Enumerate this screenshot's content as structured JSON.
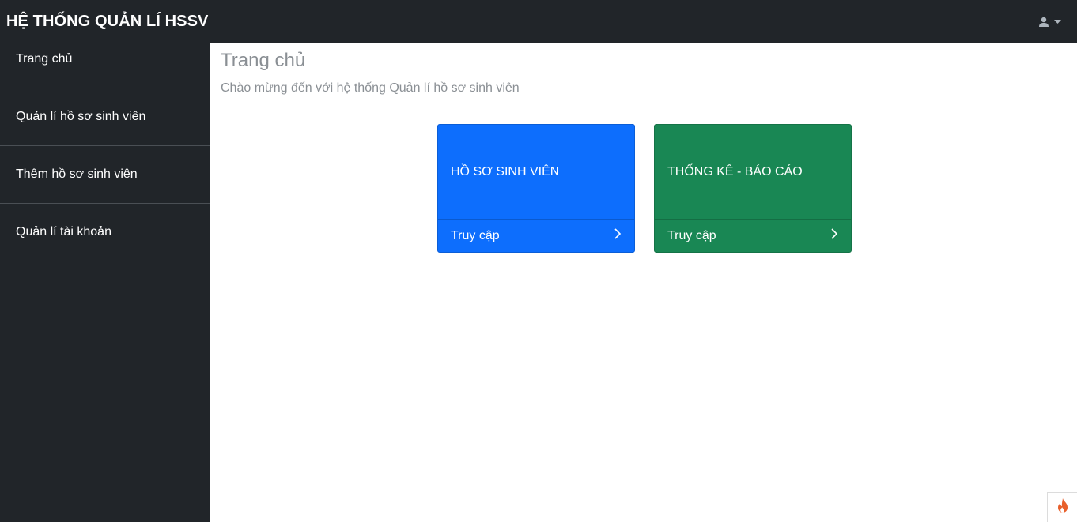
{
  "header": {
    "brand": "HỆ THỐNG QUẢN LÍ HSSV",
    "user_icon": "user-icon",
    "dropdown_icon": "caret-down-icon"
  },
  "sidebar": {
    "items": [
      {
        "label": "Trang chủ"
      },
      {
        "label": "Quản lí hồ sơ sinh viên"
      },
      {
        "label": "Thêm hồ sơ sinh viên"
      },
      {
        "label": "Quản lí tài khoản"
      }
    ]
  },
  "main": {
    "title": "Trang chủ",
    "subtitle": "Chào mừng đến với hệ thống Quản lí hồ sơ sinh viên",
    "cards": [
      {
        "title": "HỒ SƠ SINH VIÊN",
        "action": "Truy cập",
        "color": "#0d6efd",
        "icon": "chevron-right-icon"
      },
      {
        "title": "THỐNG KÊ - BÁO CÁO",
        "action": "Truy cập",
        "color": "#198754",
        "icon": "chevron-right-icon"
      }
    ]
  },
  "colors": {
    "dark": "#212529",
    "muted_text": "#8a8f94",
    "flame": "#e8602c"
  },
  "corner_widget_icon": "flame-icon"
}
